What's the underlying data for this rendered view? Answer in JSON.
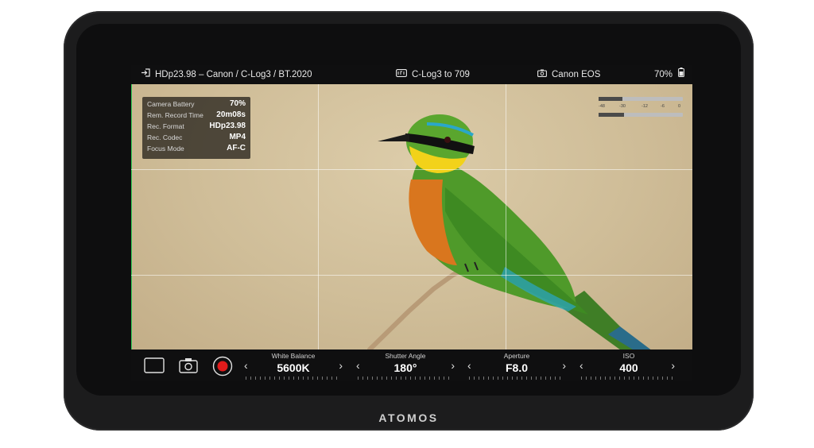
{
  "brand": "ATOMOS",
  "topbar": {
    "input": "HDp23.98 – Canon / C-Log3 / BT.2020",
    "lut": "C-Log3 to 709",
    "camera": "Canon EOS",
    "battery": "70%"
  },
  "info": {
    "rows": [
      {
        "label": "Camera Battery",
        "value": "70%"
      },
      {
        "label": "Rem. Record Time",
        "value": "20m08s"
      },
      {
        "label": "Rec. Format",
        "value": "HDp23.98"
      },
      {
        "label": "Rec. Codec",
        "value": "MP4"
      },
      {
        "label": "Focus Mode",
        "value": "AF-C"
      }
    ]
  },
  "meters": {
    "scale": [
      "-48",
      "-30",
      "-12",
      "-6",
      "0"
    ],
    "levels": [
      0.28,
      0.3
    ]
  },
  "controls": {
    "white_balance": {
      "label": "White Balance",
      "value": "5600K"
    },
    "shutter_angle": {
      "label": "Shutter Angle",
      "value": "180°"
    },
    "aperture": {
      "label": "Aperture",
      "value": "F8.0"
    },
    "iso": {
      "label": "ISO",
      "value": "400"
    },
    "prev": "‹",
    "next": "›"
  },
  "colors": {
    "record": "#e11b1b",
    "bar": "#0f0f10",
    "photo_bg": "#cfbd98",
    "bird_green": "#4f9a2a",
    "bird_yellow": "#f2d21a",
    "bird_orange": "#d9761e",
    "bird_blue": "#2aa7c9"
  }
}
